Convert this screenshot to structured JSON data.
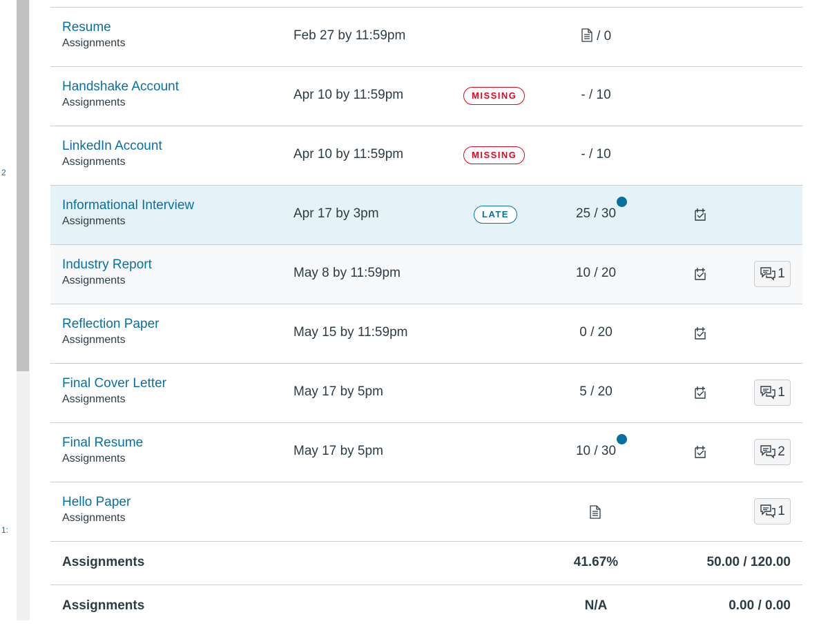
{
  "edge": {
    "marker_a": "2",
    "marker_b": "1:"
  },
  "rows": [
    {
      "title": "Resume",
      "group": "Assignments",
      "due": "Feb 27 by 11:59pm",
      "status": "",
      "score": "/ 0",
      "score_icon": "document-icon",
      "unread": false,
      "rubric": false,
      "comments": ""
    },
    {
      "title": "Handshake Account",
      "group": "Assignments",
      "due": "Apr 10 by 11:59pm",
      "status": "MISSING",
      "score": "- / 10",
      "unread": false,
      "rubric": false,
      "comments": ""
    },
    {
      "title": "LinkedIn Account",
      "group": "Assignments",
      "due": "Apr 10 by 11:59pm",
      "status": "MISSING",
      "score": "- / 10",
      "unread": false,
      "rubric": false,
      "comments": ""
    },
    {
      "title": "Informational Interview",
      "group": "Assignments",
      "due": "Apr 17 by 3pm",
      "status": "LATE",
      "score": "25 / 30",
      "unread": true,
      "rubric": true,
      "comments": ""
    },
    {
      "title": "Industry Report",
      "group": "Assignments",
      "due": "May 8 by 11:59pm",
      "status": "",
      "score": "10 / 20",
      "unread": false,
      "rubric": true,
      "comments": "1"
    },
    {
      "title": "Reflection Paper",
      "group": "Assignments",
      "due": "May 15 by 11:59pm",
      "status": "",
      "score": "0 / 20",
      "unread": false,
      "rubric": true,
      "comments": ""
    },
    {
      "title": "Final Cover Letter",
      "group": "Assignments",
      "due": "May 17 by 5pm",
      "status": "",
      "score": "5 / 20",
      "unread": false,
      "rubric": true,
      "comments": "1"
    },
    {
      "title": "Final Resume",
      "group": "Assignments",
      "due": "May 17 by 5pm",
      "status": "",
      "score": "10 / 30",
      "unread": true,
      "rubric": true,
      "comments": "2"
    },
    {
      "title": "Hello Paper",
      "group": "Assignments",
      "due": "",
      "status": "",
      "score": "",
      "score_icon": "document-icon",
      "unread": false,
      "rubric": false,
      "comments": "1"
    }
  ],
  "totals": [
    {
      "label": "Assignments",
      "percent": "41.67%",
      "points": "50.00 / 120.00"
    },
    {
      "label": "Assignments",
      "percent": "N/A",
      "points": "0.00 / 0.00"
    }
  ],
  "colors": {
    "link": "#0770a3",
    "missing": "#e0061f",
    "late": "#0770a3",
    "highlight_row": "#e5f2f8"
  }
}
